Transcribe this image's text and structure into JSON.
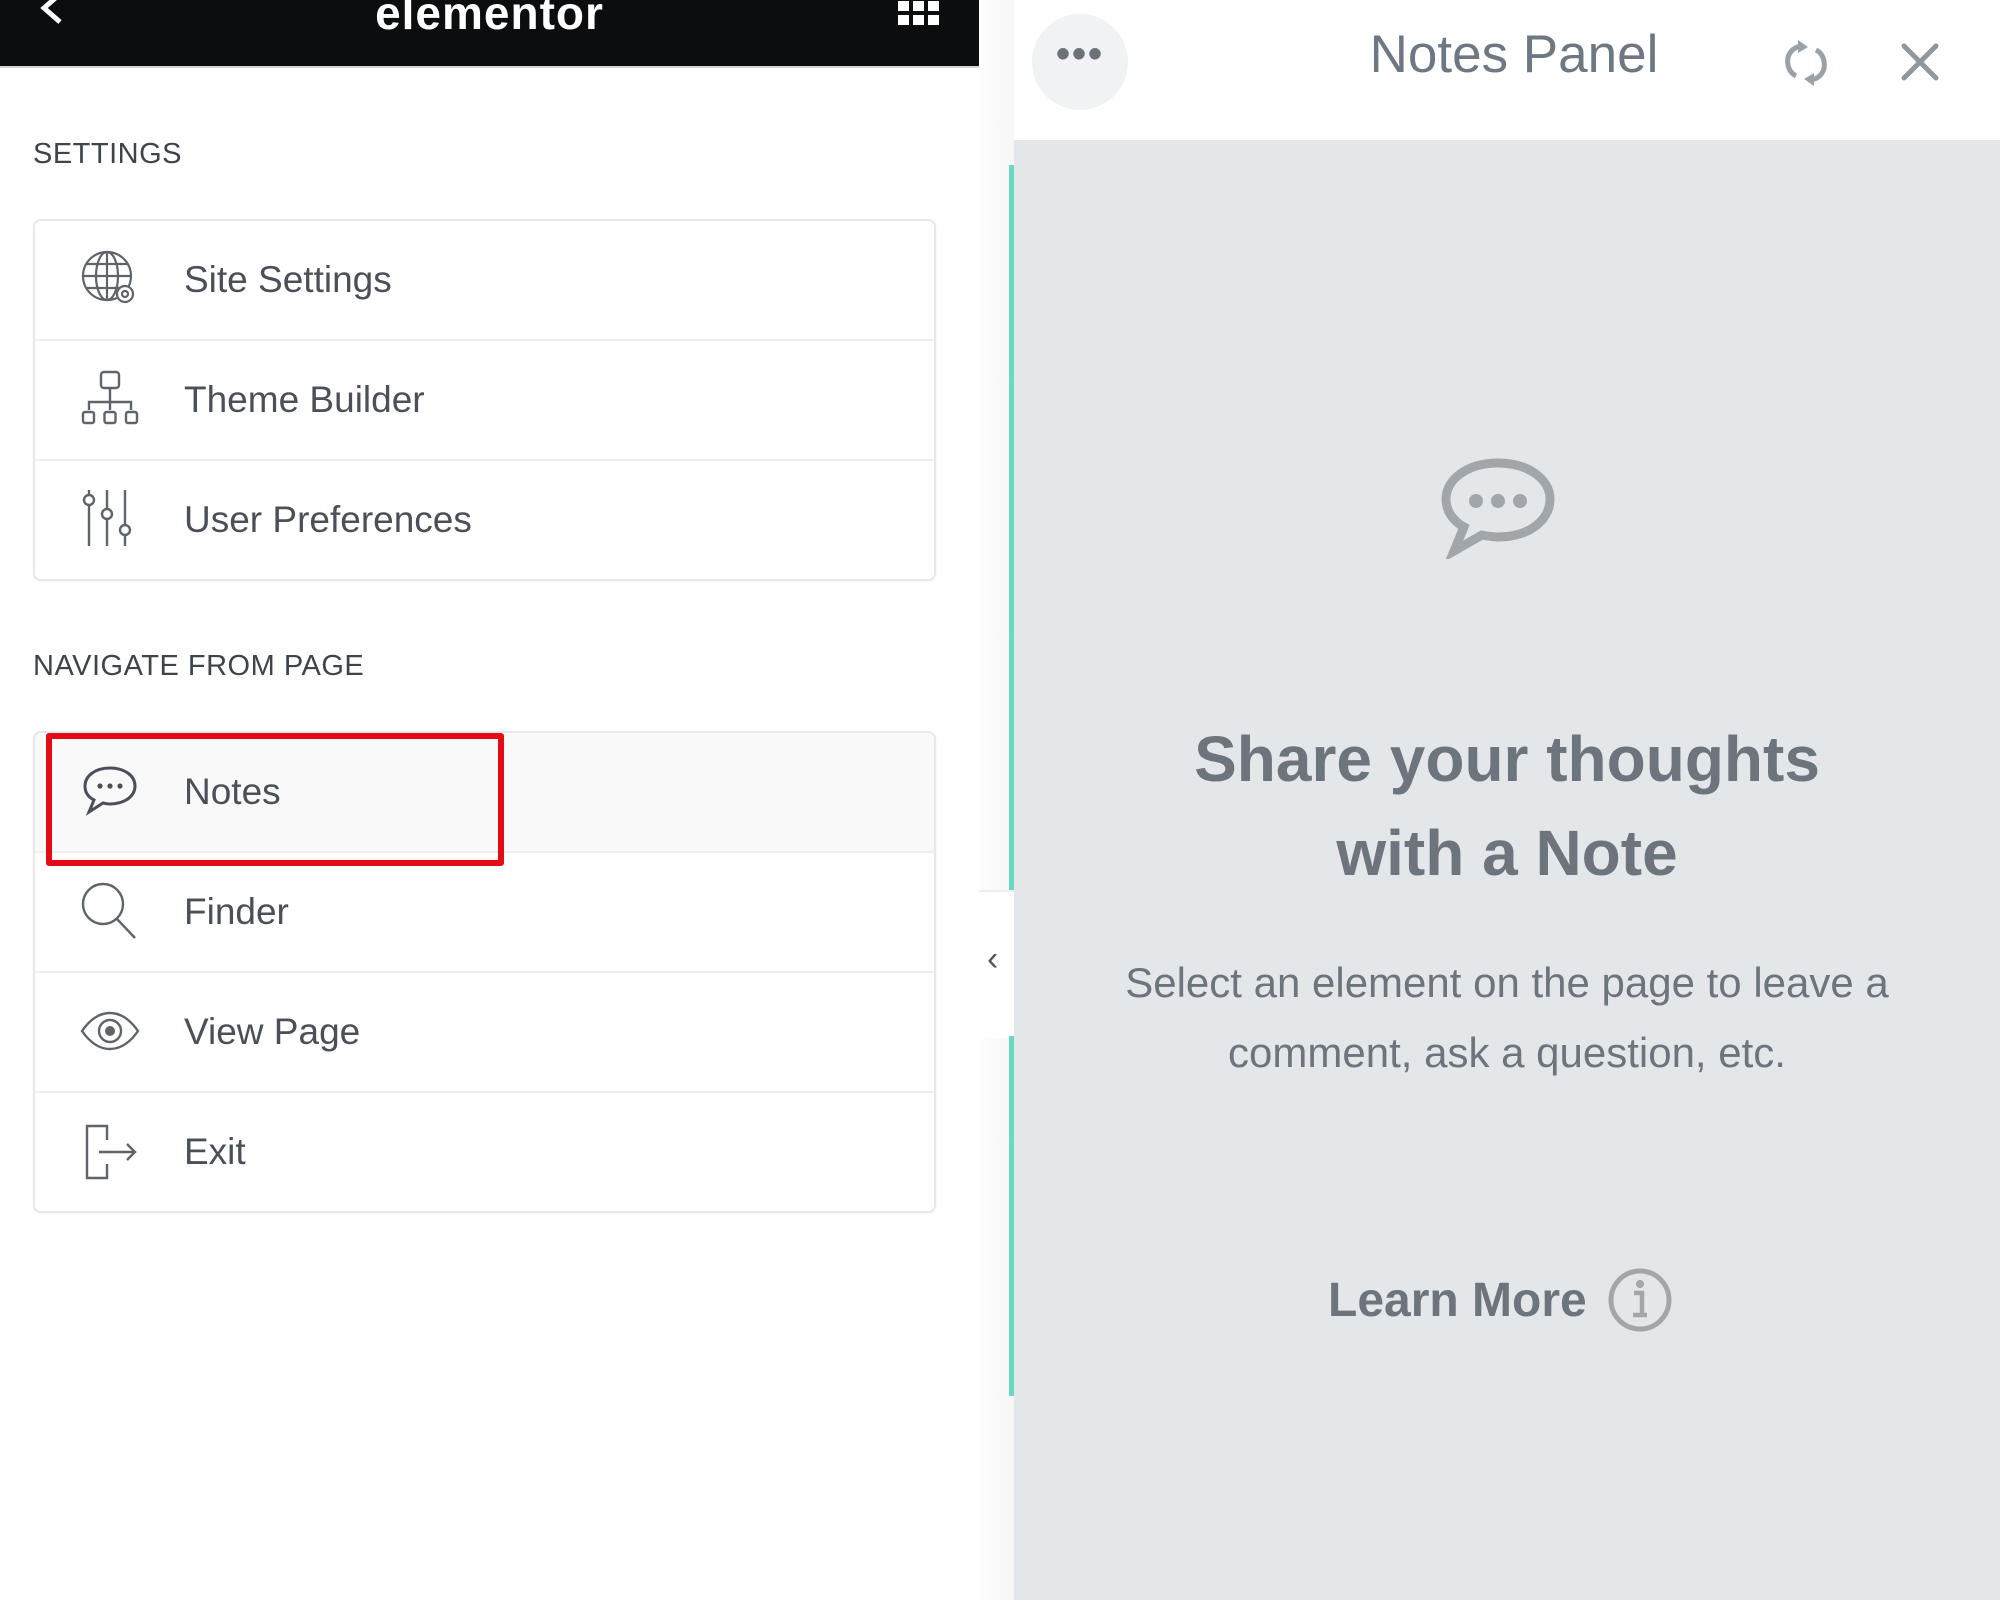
{
  "topbar": {
    "logo": "elementor",
    "back_icon": "chevron-left-icon",
    "apps_icon": "grid-icon"
  },
  "settings": {
    "title": "SETTINGS",
    "items": [
      {
        "label": "Site Settings",
        "icon": "globe-gear-icon"
      },
      {
        "label": "Theme Builder",
        "icon": "sitemap-icon"
      },
      {
        "label": "User Preferences",
        "icon": "sliders-icon"
      }
    ]
  },
  "navigate": {
    "title": "NAVIGATE FROM PAGE",
    "items": [
      {
        "label": "Notes",
        "icon": "chat-bubble-icon",
        "highlighted": true
      },
      {
        "label": "Finder",
        "icon": "search-icon"
      },
      {
        "label": "View Page",
        "icon": "eye-icon"
      },
      {
        "label": "Exit",
        "icon": "exit-icon"
      }
    ]
  },
  "notes_panel": {
    "title": "Notes Panel",
    "more_label": "•••",
    "headline_line1": "Share your thoughts",
    "headline_line2": "with a Note",
    "description_line1": "Select an element on the page to leave a",
    "description_line2": "comment, ask a question, etc.",
    "learn_more": "Learn More"
  },
  "collapse_handle": "‹",
  "colors": {
    "topbar_bg": "#0c0d0e",
    "highlight": "#e30c15",
    "accent": "#6bd8c6",
    "panel_bg": "#e4e7ea",
    "text": "#6d747c"
  }
}
